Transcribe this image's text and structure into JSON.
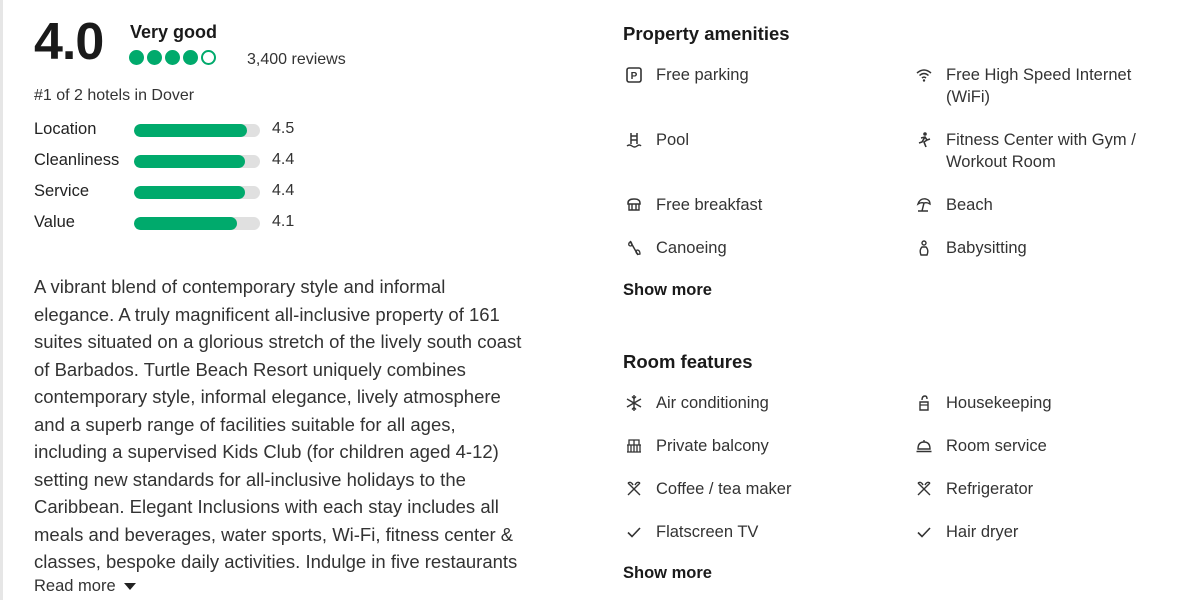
{
  "rating": {
    "score": "4.0",
    "label": "Very good",
    "bubbles_filled": 4,
    "bubbles_total": 5,
    "reviews": "3,400 reviews",
    "rank": "#1 of 2 hotels in Dover",
    "subratings": [
      {
        "label": "Location",
        "score": "4.5",
        "value": 4.5
      },
      {
        "label": "Cleanliness",
        "score": "4.4",
        "value": 4.4
      },
      {
        "label": "Service",
        "score": "4.4",
        "value": 4.4
      },
      {
        "label": "Value",
        "score": "4.1",
        "value": 4.1
      }
    ]
  },
  "description": {
    "lines": [
      "A vibrant blend of contemporary style and informal",
      "elegance. A truly magnificent all-inclusive property of 161",
      "suites situated on a glorious stretch of the lively south coast",
      "of Barbados. Turtle Beach Resort uniquely combines",
      "contemporary style, informal elegance, lively atmosphere",
      "and a superb range of facilities suitable for all ages,",
      "including a supervised Kids Club (for children aged 4-12)",
      "setting new standards for all-inclusive holidays to the",
      "Caribbean. Elegant Inclusions with each stay includes all",
      "meals and beverages, water sports, Wi-Fi, fitness center &",
      "classes, bespoke daily activities. Indulge in five restaurants"
    ],
    "read_more": "Read more"
  },
  "amenities": {
    "title": "Property amenities",
    "items": [
      {
        "label": "Free parking",
        "icon": "parking-icon"
      },
      {
        "label": "Free High Speed Internet (WiFi)",
        "icon": "wifi-icon"
      },
      {
        "label": "Pool",
        "icon": "pool-icon"
      },
      {
        "label": "Fitness Center with Gym / Workout Room",
        "icon": "fitness-icon"
      },
      {
        "label": "Free breakfast",
        "icon": "breakfast-icon"
      },
      {
        "label": "Beach",
        "icon": "beach-icon"
      },
      {
        "label": "Canoeing",
        "icon": "canoe-icon"
      },
      {
        "label": "Babysitting",
        "icon": "babysitting-icon"
      }
    ],
    "show_more": "Show more"
  },
  "room_features": {
    "title": "Room features",
    "items": [
      {
        "label": "Air conditioning",
        "icon": "snowflake-icon"
      },
      {
        "label": "Housekeeping",
        "icon": "housekeeping-icon"
      },
      {
        "label": "Private balcony",
        "icon": "balcony-icon"
      },
      {
        "label": "Room service",
        "icon": "room-service-icon"
      },
      {
        "label": "Coffee / tea maker",
        "icon": "utensils-icon"
      },
      {
        "label": "Refrigerator",
        "icon": "utensils-icon"
      },
      {
        "label": "Flatscreen TV",
        "icon": "check-icon"
      },
      {
        "label": "Hair dryer",
        "icon": "check-icon"
      }
    ],
    "show_more": "Show more"
  },
  "colors": {
    "accent": "#00aa6c",
    "track": "#e0e0e0"
  }
}
